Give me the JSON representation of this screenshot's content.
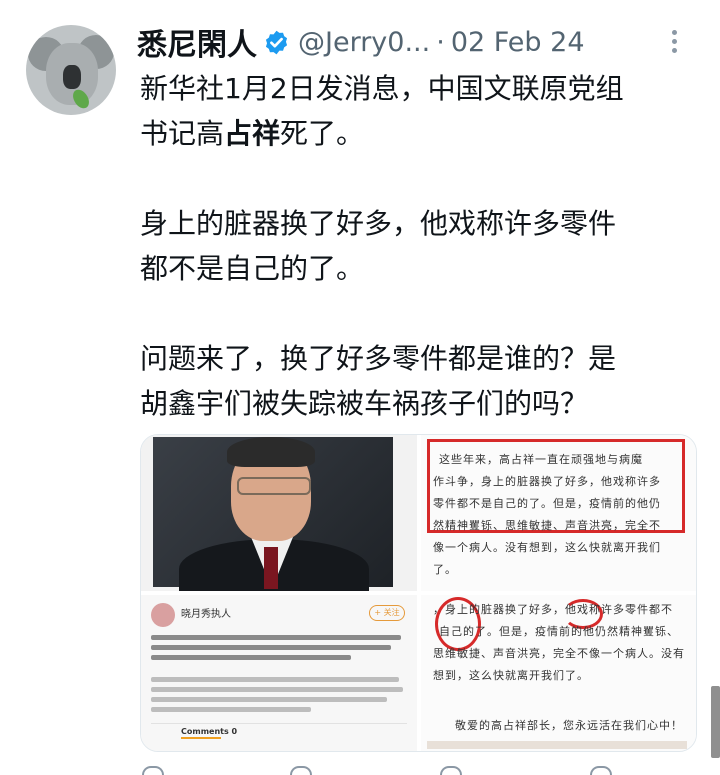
{
  "tweet": {
    "author": {
      "display_name": "悉尼閑人",
      "handle": "@Jerry0...",
      "verified": true,
      "avatar_icon": "koala-avatar"
    },
    "separator": "·",
    "date": "02 Feb 24",
    "text": {
      "p1a": "新华社1月2日发消息，中国文联原党组",
      "p1b_prefix": "书记高",
      "p1b_bold": "占祥",
      "p1b_suffix": "死了。",
      "p2a": "身上的脏器换了好多，他戏称许多零件",
      "p2b": "都不是自己的了。",
      "p3a": "问题来了，换了好多零件都是谁的？是",
      "p3b": "胡鑫宇们被失踪被车祸孩子们的吗？"
    },
    "media": {
      "top_right_lines": [
        "这些年来，高占祥一直在顽强地与病魔",
        "作斗争，身上的脏器换了好多，他戏称许多",
        "零件都不是自己的了。但是，疫情前的他仍",
        "然精神矍铄、思维敏捷、声音洪亮，完全不",
        "像一个病人。没有想到，这么快就离开我们",
        "了。"
      ],
      "bottom_left": {
        "name": "晓月秀执人",
        "follow": "+ 关注",
        "comments_label": "Comments 0"
      },
      "bottom_right_lines": [
        "，身上的脏器换了好多，他戏称许多零件都不",
        "自己的了。但是，疫情前的他仍然精神矍铄、",
        "思维敏捷、声音洪亮，完全不像一个病人。没有",
        "想到，这么快就离开我们了。",
        "",
        "敬爱的高占祥部长，您永远活在我们心中！"
      ]
    }
  },
  "colors": {
    "verified_blue": "#1d9bf0",
    "secondary_text": "#536471",
    "highlight_red": "#d62a2a"
  }
}
